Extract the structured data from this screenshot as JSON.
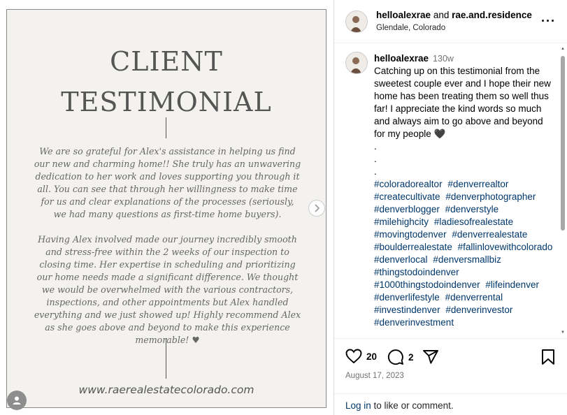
{
  "card": {
    "title_line1": "CLIENT",
    "title_line2": "TESTIMONIAL",
    "paragraph1": "We are so grateful for Alex's assistance in helping us find our new and charming home!! She truly has an unwavering dedication to her work and loves supporting you through it all. You can see that through her willingness to make time for us and clear explanations of the processes (seriously, we had many questions as first-time home buyers).",
    "paragraph2": "Having Alex involved made our journey incredibly smooth and stress-free within the 2 weeks of our inspection to closing time. Her expertise in scheduling and prioritizing our home needs made a significant difference. We thought we would be overwhelmed with the various contractors, inspections, and other appointments but Alex handled everything and we just showed up! Highly recommend Alex as she goes above and beyond to make this experience memorable! ♥",
    "url": "www.raerealestatecolorado.com"
  },
  "header": {
    "user1": "helloalexrae",
    "joiner": "and",
    "user2": "rae.and.residence",
    "location": "Glendale, Colorado",
    "more_label": "···"
  },
  "caption": {
    "username": "helloalexrae",
    "time": "130w",
    "text": "Catching up on this testimonial from the sweetest couple ever and I hope their new home has been treating them so well thus far! I appreciate the kind words so much and always aim to go above and beyond for my people 🖤",
    "dot1": ".",
    "dot2": ".",
    "dot3": ".",
    "hashtags": [
      "#coloradorealtor",
      "#denverrealtor",
      "#createcultivate",
      "#denverphotographer",
      "#denverblogger",
      "#denverstyle",
      "#milehighcity",
      "#ladiesofrealestate",
      "#movingtodenver",
      "#denverrealestate",
      "#boulderrealestate",
      "#fallinlovewithcolorado",
      "#denverlocal",
      "#denversmallbiz",
      "#thingstodoindenver",
      "#1000thingstodoindenver",
      "#lifeindenver",
      "#denverlifestyle",
      "#denverrental",
      "#investindenver",
      "#denverinvestor",
      "#denverinvestment"
    ]
  },
  "actions": {
    "likes": "20",
    "comments": "2",
    "date": "August 17, 2023",
    "login_link": "Log in",
    "login_rest": " to like or comment."
  }
}
